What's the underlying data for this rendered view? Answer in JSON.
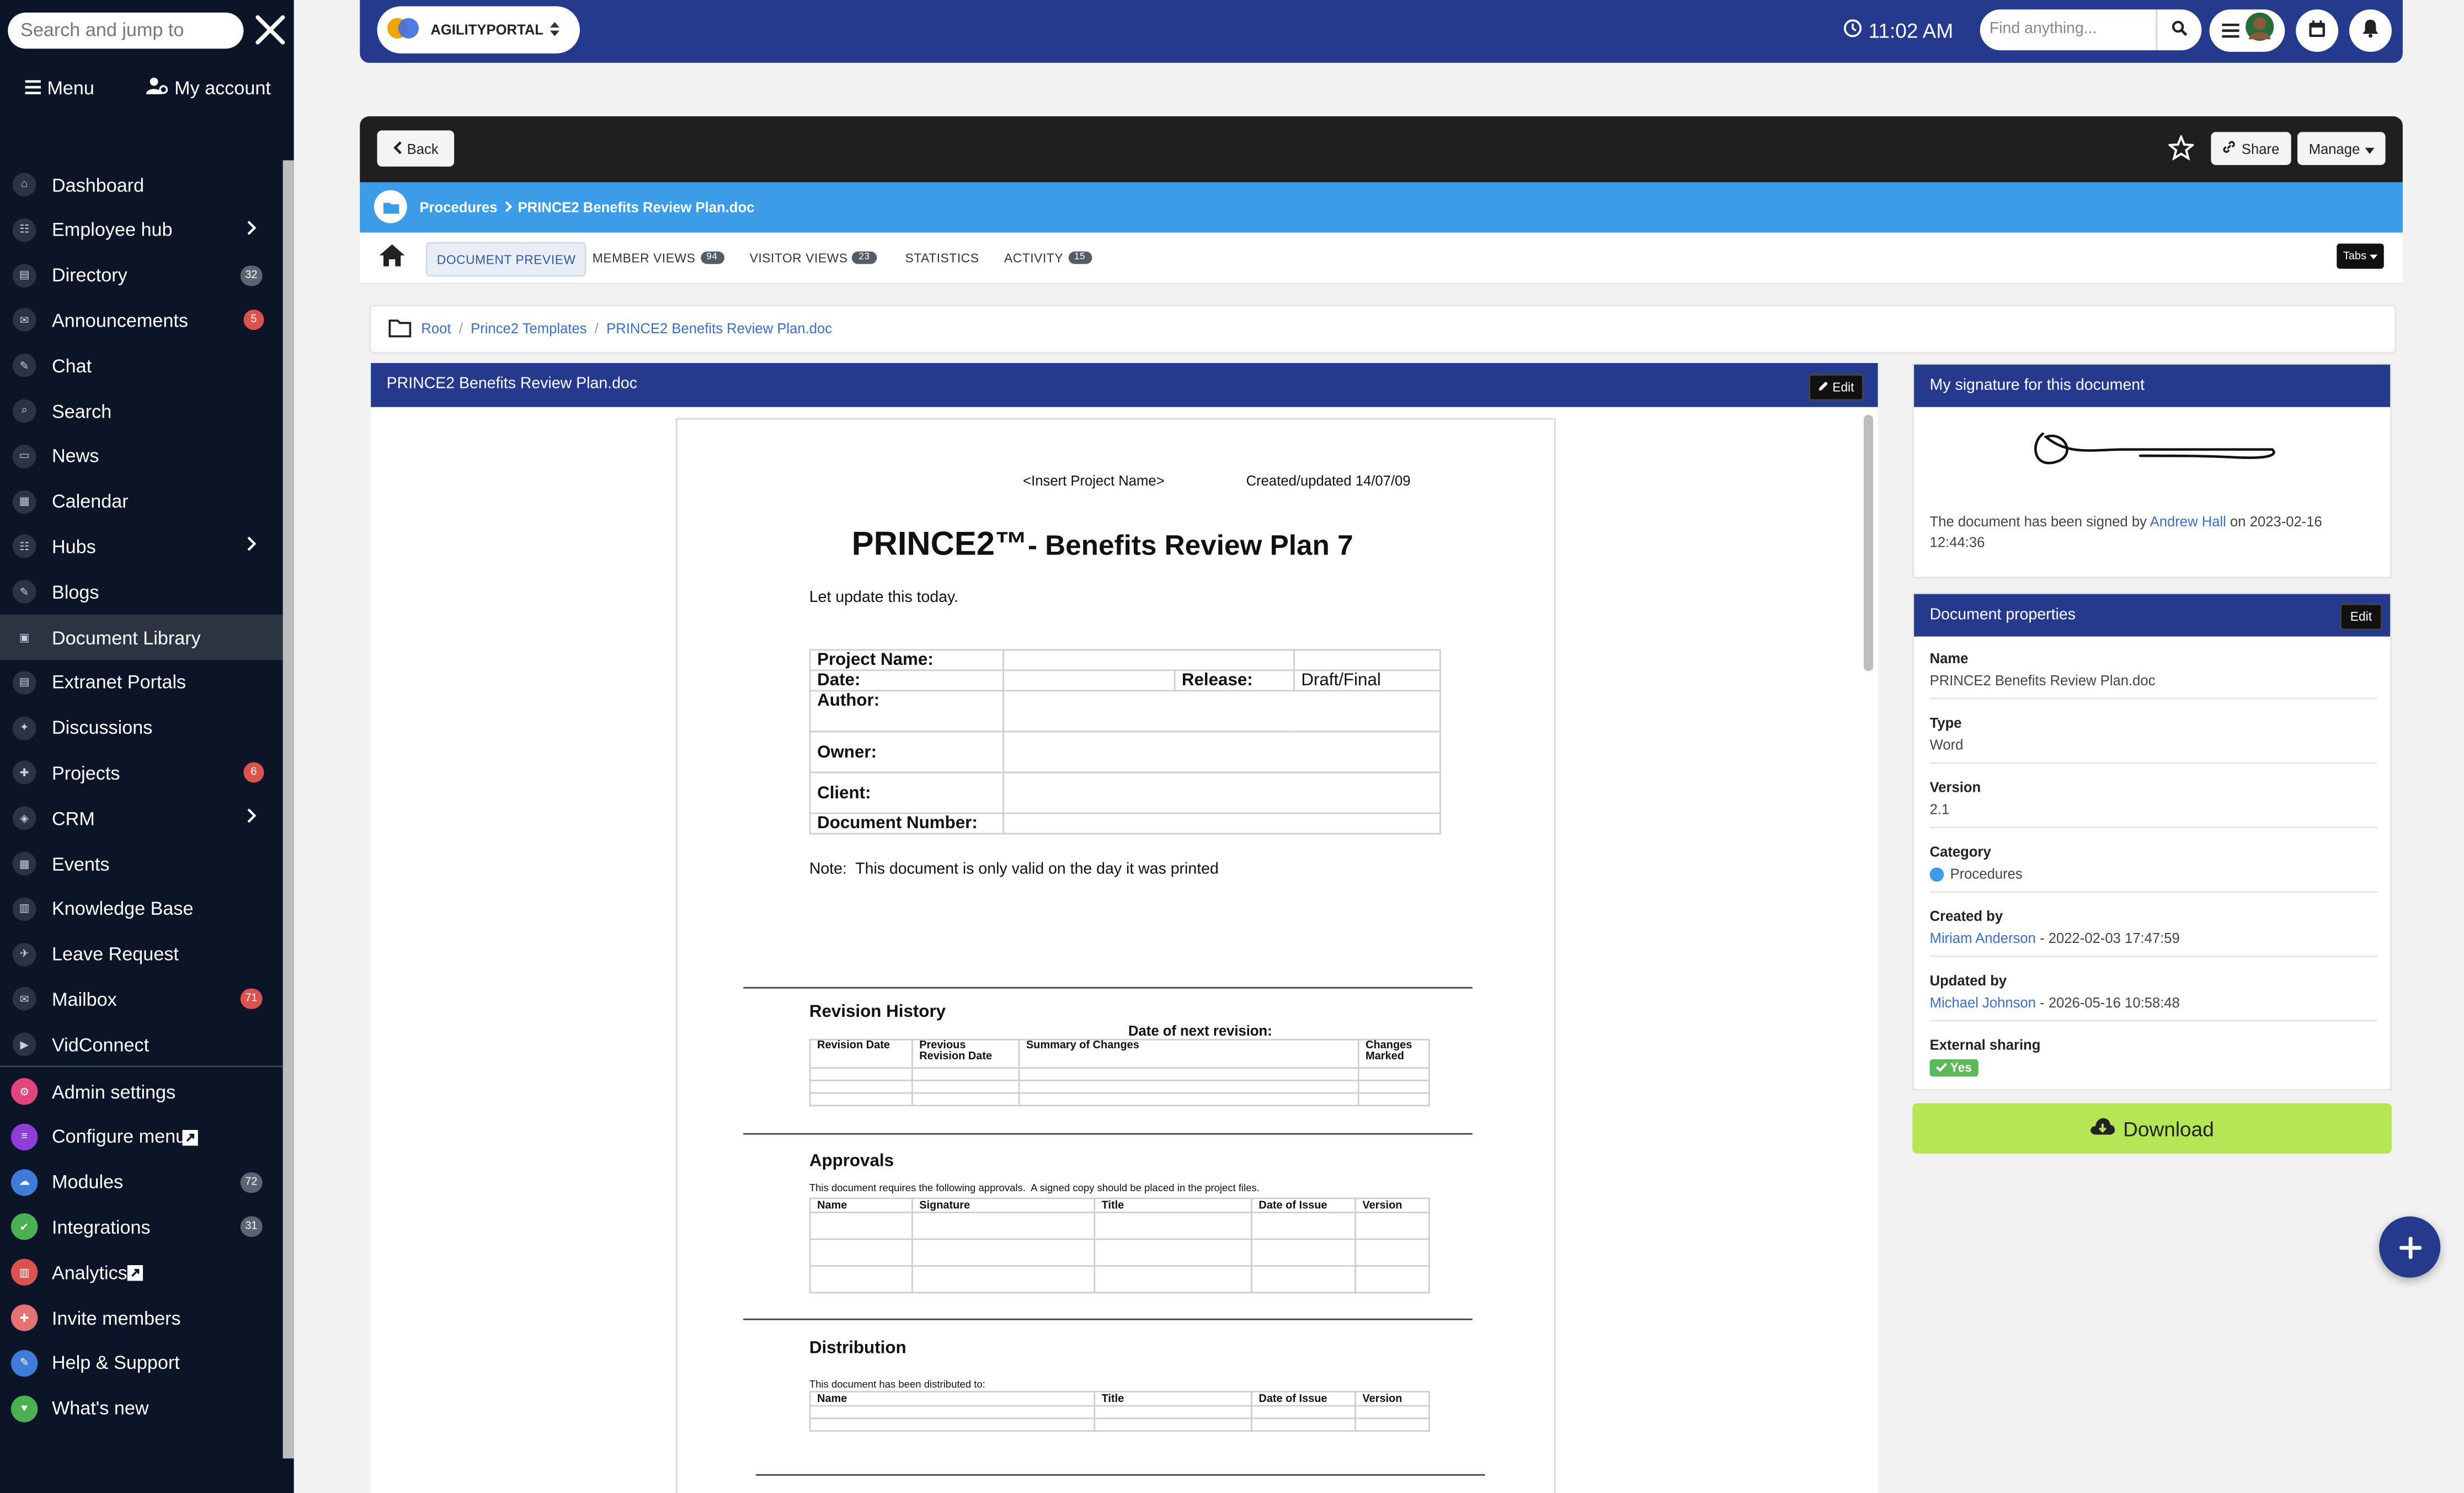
{
  "sidebar": {
    "search_placeholder": "Search and jump to",
    "menu_label": "Menu",
    "account_label": "My account",
    "items": [
      {
        "label": "Dashboard"
      },
      {
        "label": "Employee hub"
      },
      {
        "label": "Directory",
        "badge": "32"
      },
      {
        "label": "Announcements",
        "badge": "5"
      },
      {
        "label": "Chat"
      },
      {
        "label": "Search"
      },
      {
        "label": "News"
      },
      {
        "label": "Calendar"
      },
      {
        "label": "Hubs"
      },
      {
        "label": "Blogs"
      },
      {
        "label": "Document Library"
      },
      {
        "label": "Extranet Portals"
      },
      {
        "label": "Discussions"
      },
      {
        "label": "Projects",
        "badge": "6"
      },
      {
        "label": "CRM"
      },
      {
        "label": "Events"
      },
      {
        "label": "Knowledge Base"
      },
      {
        "label": "Leave Request"
      },
      {
        "label": "Mailbox",
        "badge": "71"
      },
      {
        "label": "VidConnect"
      }
    ],
    "admin_items": [
      {
        "label": "Admin settings",
        "color": "#e0457b"
      },
      {
        "label": "Configure menu",
        "color": "#8e3fd8"
      },
      {
        "label": "Modules",
        "badge": "72",
        "color": "#3f7bd8"
      },
      {
        "label": "Integrations",
        "badge": "31",
        "color": "#4caf50"
      },
      {
        "label": "Analytics",
        "color": "#d9534f"
      },
      {
        "label": "Invite members",
        "color": "#e57373"
      },
      {
        "label": "Help & Support",
        "color": "#3f7bd8"
      },
      {
        "label": "What's new",
        "color": "#4caf50"
      }
    ]
  },
  "topbar": {
    "brand": "AGILITYPORTAL",
    "time": "11:02 AM",
    "find_placeholder": "Find anything..."
  },
  "doc_header": {
    "back_label": "Back",
    "share_label": "Share",
    "manage_label": "Manage"
  },
  "blue_bar": {
    "crumb_parent": "Procedures",
    "crumb_current": "PRINCE2 Benefits Review Plan.doc"
  },
  "tabs": {
    "items": [
      {
        "label": "DOCUMENT PREVIEW"
      },
      {
        "label": "MEMBER VIEWS",
        "count": "94"
      },
      {
        "label": "VISITOR VIEWS",
        "count": "23"
      },
      {
        "label": "STATISTICS"
      },
      {
        "label": "ACTIVITY",
        "count": "15"
      }
    ],
    "tabs_button": "Tabs"
  },
  "breadcrumb": {
    "root": "Root",
    "folder": "Prince2 Templates",
    "file": "PRINCE2 Benefits Review Plan.doc"
  },
  "document": {
    "panel_title": "PRINCE2 Benefits Review Plan.doc",
    "edit_label": "Edit",
    "header_project": "<Insert Project Name>",
    "header_created": "Created/updated 14/07/09",
    "title_main": "PRINCE2™",
    "title_rest": "- Benefits Review Plan 7",
    "intro": "Let update this today.",
    "fields": {
      "project_name": "Project Name:",
      "date": "Date:",
      "release": "Release:",
      "release_value": "Draft/Final",
      "author": "Author:",
      "owner": "Owner:",
      "client": "Client:",
      "doc_number": "Document Number:"
    },
    "note": "Note:  This document is only valid on the day it was printed",
    "revision_history": {
      "heading": "Revision History",
      "next_revision": "Date of next revision:",
      "columns": [
        "Revision Date",
        "Previous Revision Date",
        "Summary of Changes",
        "Changes Marked"
      ]
    },
    "approvals": {
      "heading": "Approvals",
      "text": "This document requires the following approvals.  A signed copy should be placed in the project files.",
      "columns": [
        "Name",
        "Signature",
        "Title",
        "Date of Issue",
        "Version"
      ]
    },
    "distribution": {
      "heading": "Distribution",
      "text": "This document has been distributed to:",
      "columns": [
        "Name",
        "Title",
        "Date of Issue",
        "Version"
      ]
    }
  },
  "signature_panel": {
    "title": "My signature for this document",
    "signed_prefix": "The document has been signed by",
    "signer": "Andrew Hall",
    "signed_on": "on 2023-02-16",
    "signed_time": "12:44:36"
  },
  "properties_panel": {
    "title": "Document properties",
    "edit_label": "Edit",
    "name_label": "Name",
    "name_value": "PRINCE2 Benefits Review Plan.doc",
    "type_label": "Type",
    "type_value": "Word",
    "version_label": "Version",
    "version_value": "2.1",
    "category_label": "Category",
    "category_value": "Procedures",
    "category_color": "#3d9ce8",
    "created_label": "Created by",
    "created_user": "Miriam Anderson",
    "created_date": "- 2022-02-03 17:47:59",
    "updated_label": "Updated by",
    "updated_user": "Michael Johnson",
    "updated_date": "- 2026-05-16 10:58:48",
    "sharing_label": "External sharing",
    "sharing_value": "Yes"
  },
  "download_label": "Download",
  "colors": {
    "primary": "#253a8c",
    "accent_blue": "#3d9ce8",
    "download_green": "#b5e655",
    "sidebar_bg": "#0c1428"
  }
}
